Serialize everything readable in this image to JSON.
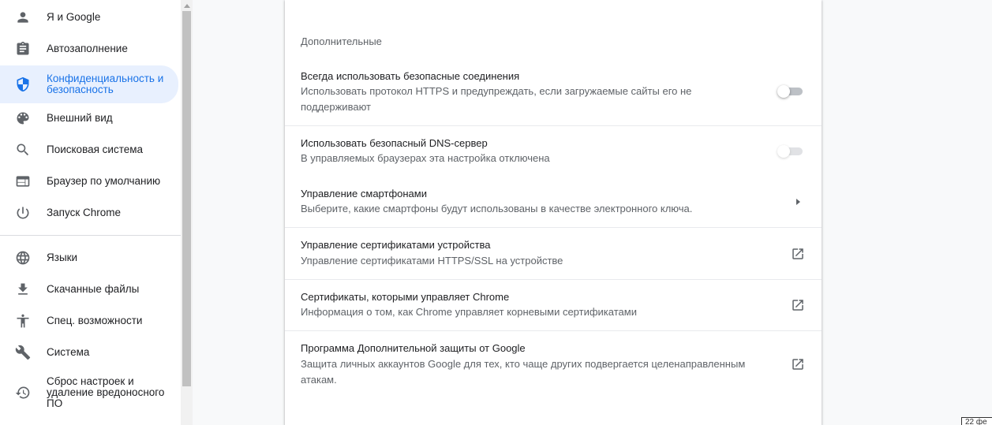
{
  "sidebar": {
    "items": [
      {
        "label": "Я и Google",
        "icon": "person-icon"
      },
      {
        "label": "Автозаполнение",
        "icon": "clipboard-icon"
      },
      {
        "label": "Конфиденциальность и безопасность",
        "icon": "shield-icon",
        "active": true
      },
      {
        "label": "Внешний вид",
        "icon": "palette-icon"
      },
      {
        "label": "Поисковая система",
        "icon": "search-icon"
      },
      {
        "label": "Браузер по умолчанию",
        "icon": "browser-icon"
      },
      {
        "label": "Запуск Chrome",
        "icon": "power-icon"
      },
      {
        "label": "Языки",
        "icon": "globe-icon"
      },
      {
        "label": "Скачанные файлы",
        "icon": "download-icon"
      },
      {
        "label": "Спец. возможности",
        "icon": "accessibility-icon"
      },
      {
        "label": "Система",
        "icon": "wrench-icon"
      },
      {
        "label": "Сброс настроек и удаление вредоносного ПО",
        "icon": "restore-icon"
      }
    ]
  },
  "main": {
    "section_title": "Дополнительные",
    "rows": [
      {
        "title": "Всегда использовать безопасные соединения",
        "subtitle": "Использовать протокол HTTPS и предупреждать, если загружаемые сайты его не поддерживают",
        "control": "toggle",
        "state": "off"
      },
      {
        "title": "Использовать безопасный DNS-сервер",
        "subtitle": "В управляемых браузерах эта настройка отключена",
        "control": "toggle",
        "state": "off-disabled"
      },
      {
        "title": "Управление смартфонами",
        "subtitle": "Выберите, какие смартфоны будут использованы в качестве электронного ключа.",
        "control": "arrow"
      },
      {
        "title": "Управление сертификатами устройства",
        "subtitle": "Управление сертификатами HTTPS/SSL на устройстве",
        "control": "external-link"
      },
      {
        "title": "Сертификаты, которыми управляет Chrome",
        "subtitle": "Информация о том, как Chrome управляет корневыми сертификатами",
        "control": "external-link"
      },
      {
        "title": "Программа Дополнительной защиты от Google",
        "subtitle": "Защита личных аккаунтов Google для тех, кто чаще других подвергается целенаправленным атакам.",
        "control": "external-link"
      }
    ]
  },
  "corner_tag": "22 фе",
  "colors": {
    "accent": "#1a73e8",
    "active_bg": "#e8f0fe",
    "text": "#202124",
    "secondary": "#5f6368"
  }
}
